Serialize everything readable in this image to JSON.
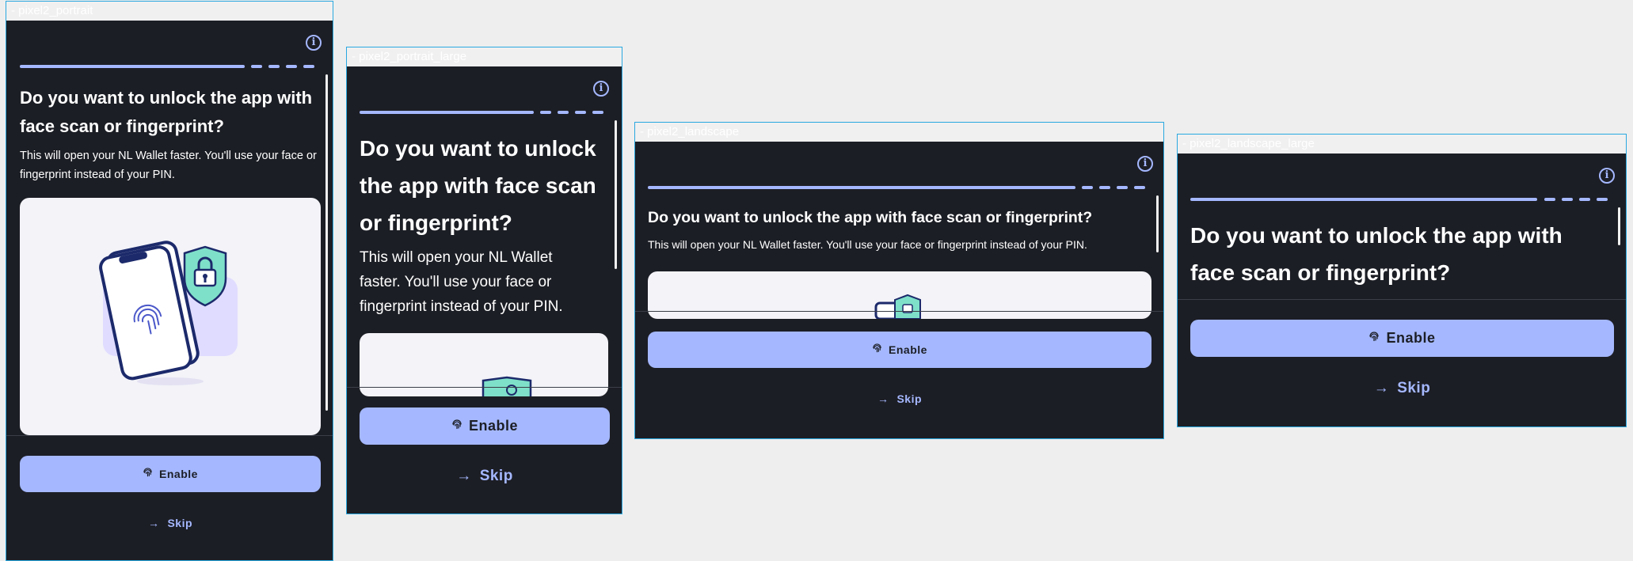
{
  "screens": [
    {
      "device_label": "- pixel2_portrait",
      "title": "Do you want to unlock the app with face scan or fingerprint?",
      "description": "This will open your NL Wallet faster. You'll use your face or fingerprint instead of your PIN.",
      "enable_label": "Enable",
      "skip_label": "Skip"
    },
    {
      "device_label": "- pixel2_portrait_large",
      "title": "Do you want to unlock the app with face scan or fingerprint?",
      "description": "This will open your NL Wallet faster. You'll use your face or fingerprint instead of your PIN.",
      "enable_label": "Enable",
      "skip_label": "Skip"
    },
    {
      "device_label": "- pixel2_landscape",
      "title": "Do you want to unlock the app with face scan or fingerprint?",
      "description": "This will open your NL Wallet faster. You'll use your face or fingerprint instead of your PIN.",
      "enable_label": "Enable",
      "skip_label": "Skip"
    },
    {
      "device_label": "- pixel2_landscape_large",
      "title": "Do you want to unlock the app with face scan or fingerprint?",
      "enable_label": "Enable",
      "skip_label": "Skip"
    }
  ],
  "icons": {
    "info": "info-circle-icon",
    "fingerprint": "fingerprint-icon",
    "skip": "arrow-right-icon"
  },
  "colors": {
    "background": "#1c1e25",
    "accent": "#a5b8ff",
    "text": "#ffffff",
    "card": "#f3f3f8",
    "frame_border": "#29a8e0",
    "illustration_green": "#7fe0c9",
    "illustration_navy": "#1c2a6b",
    "illustration_lavender": "#e0dcff"
  }
}
